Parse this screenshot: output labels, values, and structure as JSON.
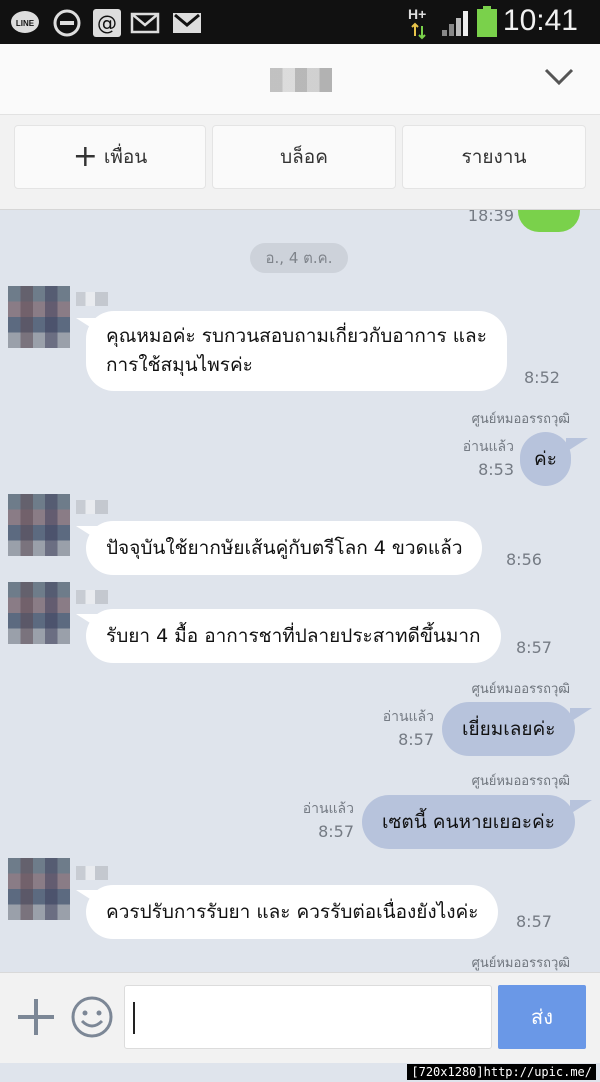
{
  "status": {
    "time": "10:41",
    "network": "H+"
  },
  "header": {
    "chevron_icon": "chevron-down-icon"
  },
  "actions": {
    "add_friend": "เพื่อน",
    "block": "บล็อค",
    "report": "รายงาน"
  },
  "chat": {
    "prev_time": "18:39",
    "date": "อ., 4 ต.ค.",
    "messages": [
      {
        "side": "left",
        "text_line1": "คุณหมอค่ะ รบกวนสอบถามเกี่ยวกับอาการ และ",
        "text_line2": "การใช้สมุนไพรค่ะ",
        "time": "8:52"
      },
      {
        "side": "right",
        "sender": "ศูนย์หมออรรถวุฒิ",
        "read": "อ่านแล้ว",
        "text": "ค่ะ",
        "time": "8:53"
      },
      {
        "side": "left",
        "text": "ปัจจุบันใช้ยากษัยเส้นคู่กับตรีโลก 4 ขวดแล้ว",
        "time": "8:56"
      },
      {
        "side": "left",
        "text": "รับยา 4 มื้อ อาการชาที่ปลายประสาทดีขึ้นมาก",
        "time": "8:57"
      },
      {
        "side": "right",
        "sender": "ศูนย์หมออรรถวุฒิ",
        "read": "อ่านแล้ว",
        "text": "เยี่ยมเลยค่ะ",
        "time": "8:57"
      },
      {
        "side": "right",
        "sender": "ศูนย์หมออรรถวุฒิ",
        "read": "อ่านแล้ว",
        "text": "เซตนี้ คนหายเยอะค่ะ",
        "time": "8:57"
      },
      {
        "side": "left",
        "text": "ควรปรับการรับยา และ ควรรับต่อเนื่องยังไงค่ะ",
        "time": "8:57"
      },
      {
        "side": "right",
        "sender": "ศูนย์หมออรรถวุฒิ"
      }
    ]
  },
  "input": {
    "send_label": "ส่ง"
  },
  "footer": {
    "stamp": "[720x1280]http://upic.me/"
  }
}
